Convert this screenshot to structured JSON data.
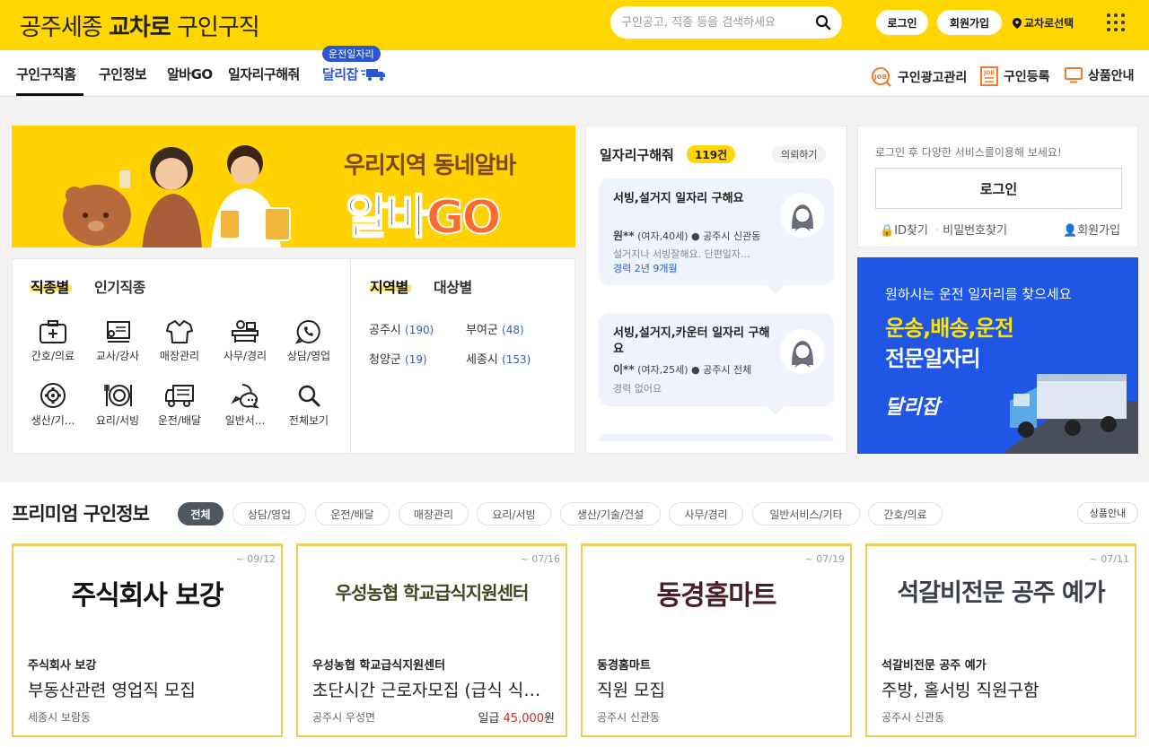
{
  "header": {
    "logo_prefix": "공주세종 ",
    "logo_bold": "교차로",
    "logo_suffix": " 구인구직",
    "search_placeholder": "구인공고, 직종 등을 검색하세요",
    "login_label": "로그인",
    "signup_label": "회원가입",
    "region_label": "교차로선택",
    "accent_color": "#ffd600"
  },
  "nav": {
    "items": [
      {
        "label": "구인구직홈"
      },
      {
        "label": "구인정보"
      },
      {
        "label": "알바GO"
      },
      {
        "label": "일자리구해줘"
      },
      {
        "label": "달리잡"
      }
    ],
    "dalijob_badge": "운전일자리",
    "right": [
      {
        "label": "구인광고관리",
        "icon": "job-manage-icon"
      },
      {
        "label": "구인등록",
        "icon": "job-register-icon"
      },
      {
        "label": "상품안내",
        "icon": "monitor-icon"
      }
    ]
  },
  "banner_albago": {
    "line1": "우리지역 동네알바",
    "line2_a": "알바",
    "line2_b": "GO"
  },
  "categories": {
    "tabs": [
      "직종별",
      "인기직종"
    ],
    "items": [
      {
        "label": "간호/의료",
        "icon": "medical-kit-icon"
      },
      {
        "label": "교사/강사",
        "icon": "teacher-board-icon"
      },
      {
        "label": "매장관리",
        "icon": "shirt-icon"
      },
      {
        "label": "사무/경리",
        "icon": "office-desk-icon"
      },
      {
        "label": "상담/영업",
        "icon": "phone-chat-icon"
      },
      {
        "label": "생산/기...",
        "icon": "gear-icon"
      },
      {
        "label": "요리/서빙",
        "icon": "cutlery-icon"
      },
      {
        "label": "운전/배달",
        "icon": "truck-icon"
      },
      {
        "label": "일반서...",
        "icon": "chat-bubble-icon"
      },
      {
        "label": "전체보기",
        "icon": "search-icon"
      }
    ]
  },
  "regions": {
    "tabs": [
      "지역별",
      "대상별"
    ],
    "items": [
      {
        "name": "공주시",
        "count": "(190)"
      },
      {
        "name": "부여군",
        "count": "(48)"
      },
      {
        "name": "청양군",
        "count": "(19)"
      },
      {
        "name": "세종시",
        "count": "(153)"
      }
    ]
  },
  "jobseek": {
    "title": "일자리구해줘",
    "count": "119건",
    "request_label": "의뢰하기",
    "cards": [
      {
        "title": "서빙,설거지 일자리 구해요",
        "name": "원**",
        "info": "(여자,40세)",
        "location": "공주시 신관동",
        "desc": "설거지나 서빙잘해요. 단편일자...",
        "career_label": "경력",
        "career_value": "2년 9개월"
      },
      {
        "title": "서빙,설거지,카운터 일자리 구해요",
        "name": "이**",
        "info": "(여자,25세)",
        "location": "공주시 전체",
        "career_text": "경력 없어요"
      }
    ]
  },
  "login": {
    "message": "로그인 후 다양한 서비스를이용해 보세요!",
    "button": "로그인",
    "find_id": "ID찾기",
    "find_pw": "비밀번호찾기",
    "signup": "회원가입"
  },
  "banner_dali": {
    "line1": "원하시는 운전 일자리를 찾으세요",
    "line2": "운송,배송,운전",
    "line3": "전문일자리",
    "logo": "달리잡"
  },
  "premium": {
    "title": "프리미엄 구인정보",
    "chips": [
      "전체",
      "상담/영업",
      "운전/배달",
      "매장관리",
      "요리/서빙",
      "생산/기술/건설",
      "사무/경리",
      "일반서비스/기타",
      "간호/의료"
    ],
    "product_info": "상품안내",
    "cards": [
      {
        "date": "~ 09/12",
        "logo": "주식회사 보강",
        "logo_color": "#111111",
        "company": "주식회사 보강",
        "title": "부동산관련 영업직 모집",
        "location": "세종시 보람동"
      },
      {
        "date": "~ 07/16",
        "logo": "우성농협 학교급식지원센터",
        "logo_color": "#3a4a1f",
        "company": "우성농협 학교급식지원센터",
        "title": "초단시간 근로자모집 (급식 식자재 배송)",
        "location": "공주시 우성면",
        "wage_label": "일급",
        "wage_value": "45,000",
        "wage_unit": "원"
      },
      {
        "date": "~ 07/19",
        "logo": "동경홈마트",
        "logo_color": "#4a1e26",
        "company": "동경홈마트",
        "title": "직원 모집",
        "location": "공주시 신관동"
      },
      {
        "date": "~ 07/11",
        "logo": "석갈비전문 공주 예가",
        "logo_color": "#3a3f4a",
        "company": "석갈비전문 공주 예가",
        "title": "주방, 홀서빙 직원구함",
        "location": "공주시 신관동"
      }
    ]
  }
}
